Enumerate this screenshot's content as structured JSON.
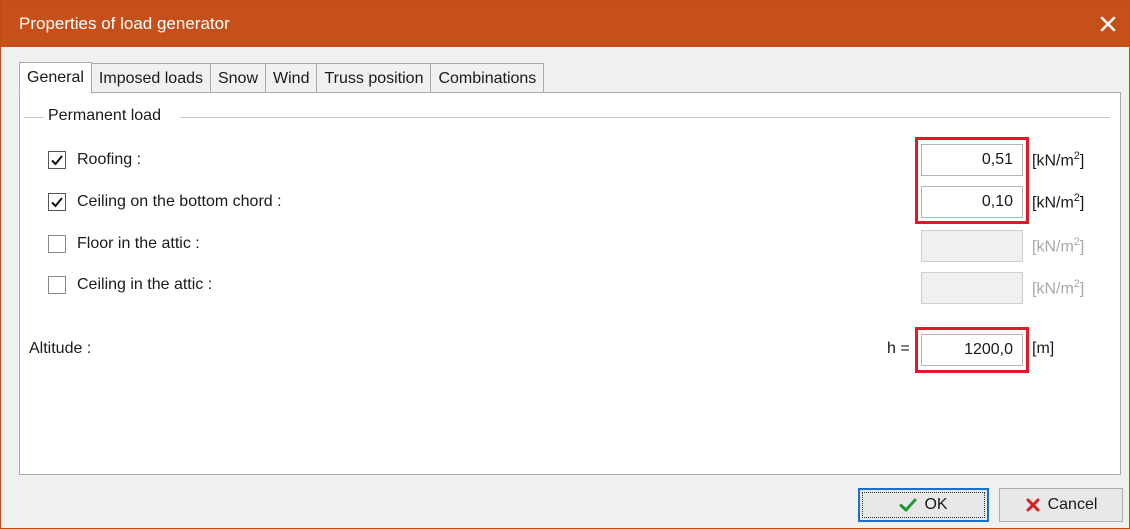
{
  "window": {
    "title": "Properties of load generator"
  },
  "tabs": [
    {
      "label": "General",
      "active": true
    },
    {
      "label": "Imposed loads",
      "active": false
    },
    {
      "label": "Snow",
      "active": false
    },
    {
      "label": "Wind",
      "active": false
    },
    {
      "label": "Truss position",
      "active": false
    },
    {
      "label": "Combinations",
      "active": false
    }
  ],
  "permanent_load": {
    "group_label": "Permanent load",
    "rows": [
      {
        "label": "Roofing :",
        "checked": true,
        "value": "0,51",
        "unit": "[kN/m",
        "unit_exp": "2",
        "unit_close": "]"
      },
      {
        "label": "Ceiling on the bottom chord :",
        "checked": true,
        "value": "0,10",
        "unit": "[kN/m",
        "unit_exp": "2",
        "unit_close": "]"
      },
      {
        "label": "Floor in the attic :",
        "checked": false,
        "value": "",
        "unit": "[kN/m",
        "unit_exp": "2",
        "unit_close": "]"
      },
      {
        "label": "Ceiling in the attic :",
        "checked": false,
        "value": "",
        "unit": "[kN/m",
        "unit_exp": "2",
        "unit_close": "]"
      }
    ]
  },
  "altitude": {
    "label": "Altitude :",
    "symbol": "h =",
    "value": "1200,0",
    "unit": "[m]"
  },
  "buttons": {
    "ok": "OK",
    "cancel": "Cancel"
  },
  "colors": {
    "titlebar": "#c7501a",
    "highlight": "#e01827",
    "ok_check": "#1f9a2e",
    "cancel_x": "#d81e1e"
  }
}
